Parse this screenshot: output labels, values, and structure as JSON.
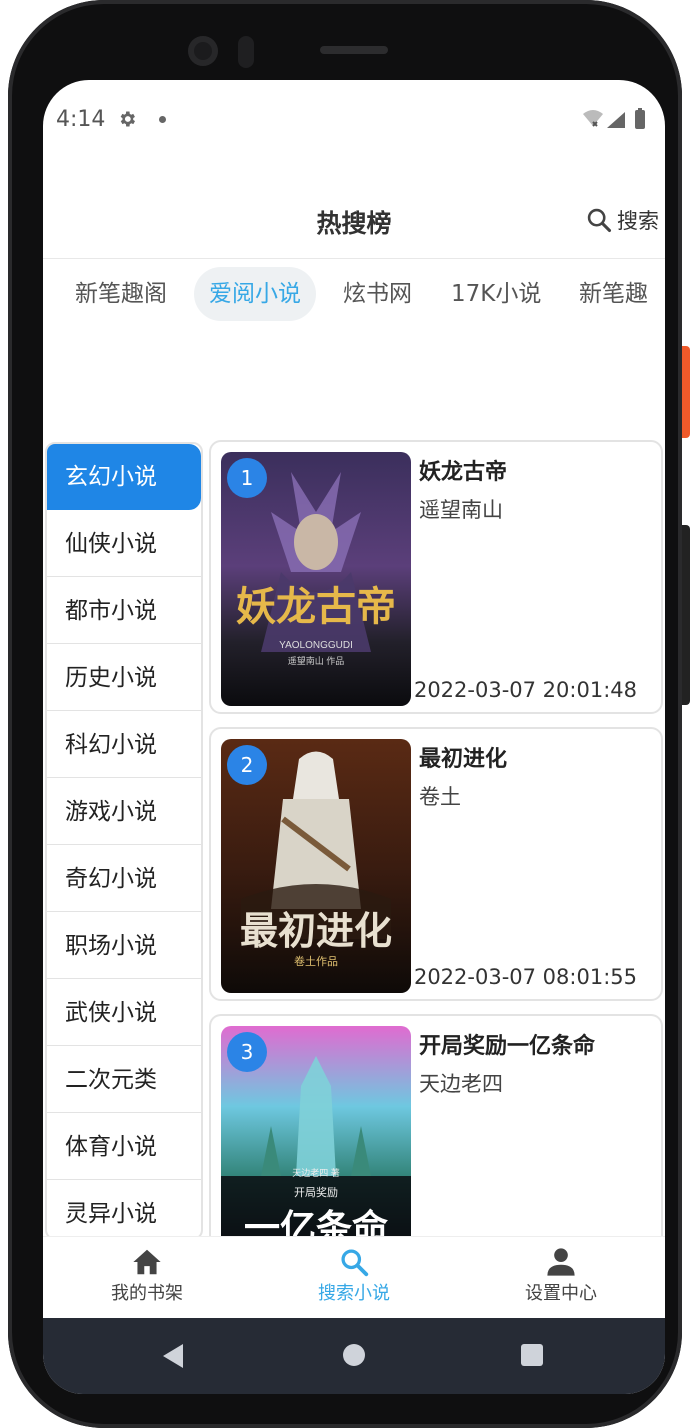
{
  "status": {
    "time": "4:14"
  },
  "header": {
    "title": "热搜榜",
    "search_label": "搜索"
  },
  "tabs": [
    "新笔趣阁",
    "爱阅小说",
    "炫书网",
    "17K小说",
    "新笔趣"
  ],
  "active_tab": "爱阅小说",
  "categories": [
    "玄幻小说",
    "仙侠小说",
    "都市小说",
    "历史小说",
    "科幻小说",
    "游戏小说",
    "奇幻小说",
    "职场小说",
    "武侠小说",
    "二次元类",
    "体育小说",
    "灵异小说"
  ],
  "books": [
    {
      "rank": "1",
      "title": "妖龙古帝",
      "author": "遥望南山",
      "time": "2022-03-07 20:01:48",
      "cover_text": "妖龙古帝",
      "cover_sub": "YAOLONGGUDI",
      "cover_author": "遥望南山 作品"
    },
    {
      "rank": "2",
      "title": "最初进化",
      "author": "卷土",
      "time": "2022-03-07 08:01:55",
      "cover_text": "最初进化",
      "cover_author": "卷土作品"
    },
    {
      "rank": "3",
      "title": "开局奖励一亿条命",
      "author": "天边老四",
      "time": "",
      "cover_text": "一亿条命",
      "cover_sub": "开局奖励",
      "cover_author": "天边老四 著"
    }
  ],
  "bottom_nav": [
    {
      "label": "我的书架",
      "icon": "home-icon"
    },
    {
      "label": "搜索小说",
      "icon": "search-icon"
    },
    {
      "label": "设置中心",
      "icon": "person-icon"
    }
  ],
  "colors": {
    "accent": "#37a8e6",
    "category_active": "#1f86e6",
    "rank_badge": "#2b84e6"
  }
}
